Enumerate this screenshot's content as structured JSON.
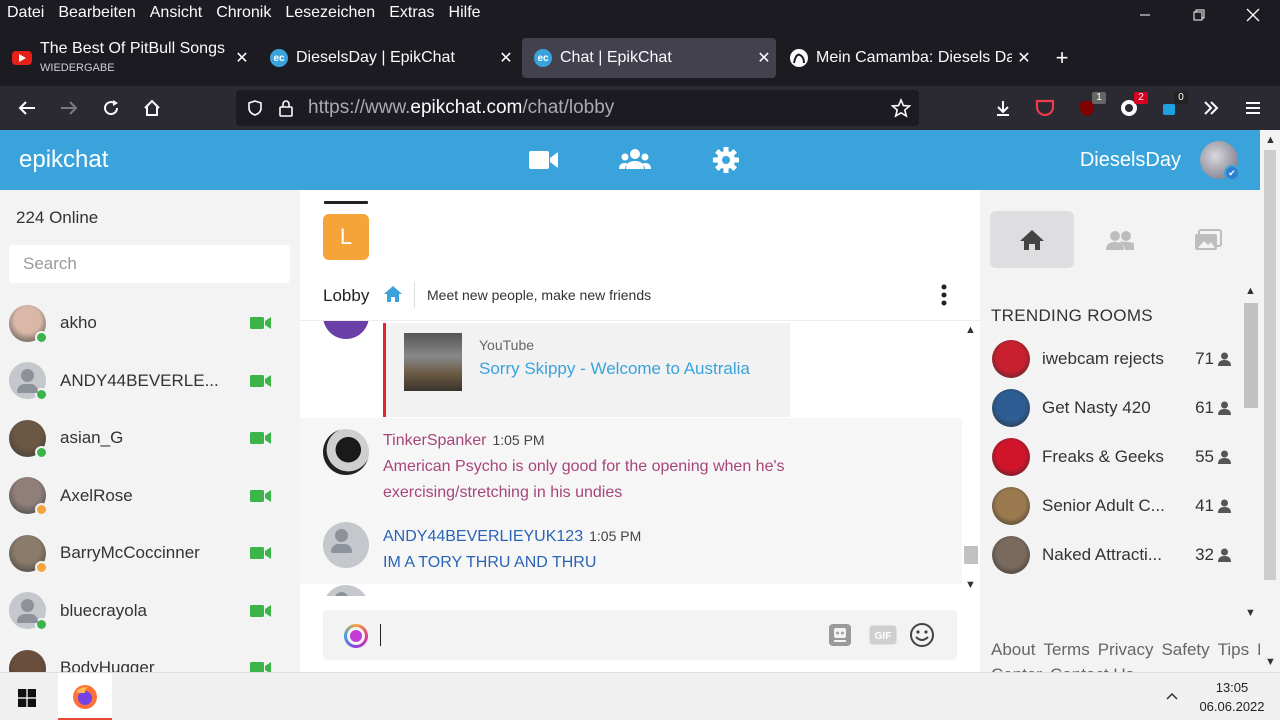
{
  "menubar": [
    "Datei",
    "Bearbeiten",
    "Ansicht",
    "Chronik",
    "Lesezeichen",
    "Extras",
    "Hilfe"
  ],
  "tabs": [
    {
      "title": "The Best Of PitBull Songs N",
      "subtitle": "WIEDERGABE",
      "favicon": "youtube-icon",
      "active": false
    },
    {
      "title": "DieselsDay | EpikChat",
      "favicon": "epikchat-icon",
      "active": false
    },
    {
      "title": "Chat | EpikChat",
      "favicon": "epikchat-icon",
      "active": true
    },
    {
      "title": "Mein Camamba: Diesels Da",
      "favicon": "camamba-icon",
      "active": false
    }
  ],
  "navbar": {
    "url_prefix": "https://www.",
    "url_host": "epikchat.com",
    "url_path": "/chat/lobby",
    "ext_badges": {
      "ublock": "1",
      "ext2": "2",
      "ext3": "0"
    }
  },
  "app": {
    "brand": "epikchat",
    "username": "DieselsDay",
    "online_label": "224 Online",
    "search_placeholder": "Search"
  },
  "users": [
    {
      "name": "akho",
      "status": "online",
      "avatar": "photo",
      "color": "#d9b8a8"
    },
    {
      "name": "ANDY44BEVERLE...",
      "status": "online",
      "avatar": "default"
    },
    {
      "name": "asian_G",
      "status": "online",
      "avatar": "photo",
      "color": "#6b5743"
    },
    {
      "name": "AxelRose",
      "status": "away",
      "avatar": "photo",
      "color": "#8f7e7a"
    },
    {
      "name": "BarryMcCoccinner",
      "status": "away",
      "avatar": "photo",
      "color": "#8a7b6a"
    },
    {
      "name": "bluecrayola",
      "status": "online",
      "avatar": "default"
    },
    {
      "name": "BodyHugger",
      "status": "online",
      "avatar": "photo",
      "color": "#6a4e3c"
    }
  ],
  "room": {
    "logo_letter": "L",
    "name": "Lobby",
    "description": "Meet new people, make new friends"
  },
  "youtube_card": {
    "source": "YouTube",
    "title": "Sorry Skippy - Welcome to Australia"
  },
  "messages": [
    {
      "author": "TinkerSpanker",
      "time": "1:05 PM",
      "lines": [
        "American Psycho is only good for the opening when he's",
        "exercising/stretching in his undies"
      ],
      "color": "#a6467a",
      "bg": "#f6f6f7"
    },
    {
      "author": "ANDY44BEVERLIEYUK123",
      "time": "1:05 PM",
      "lines": [
        "IM A TORY THRU AND THRU"
      ],
      "color": "#2a64b5",
      "bg": "#f6f6f7"
    }
  ],
  "trending": {
    "title": "TRENDING ROOMS",
    "rooms": [
      {
        "name": "iwebcam rejects",
        "count": "71",
        "color": "#c8202e"
      },
      {
        "name": "Get Nasty 420",
        "count": "61",
        "color": "#2d5d92"
      },
      {
        "name": "Freaks & Geeks",
        "count": "55",
        "color": "#d0152a"
      },
      {
        "name": "Senior Adult C...",
        "count": "41",
        "color": "#9c7a4f"
      },
      {
        "name": "Naked Attracti...",
        "count": "32",
        "color": "#7a6a5e"
      }
    ]
  },
  "footer": {
    "links": [
      "About",
      "Terms",
      "Privacy",
      "Safety",
      "Tips",
      "Help Center",
      "Contact Us"
    ]
  },
  "taskbar": {
    "time": "13:05",
    "date": "06.06.2022"
  },
  "colors": {
    "brand_blue": "#3aa3db",
    "online_green": "#3bb54a",
    "away_orange": "#f5a43a",
    "camera_green": "#3bb54a"
  }
}
